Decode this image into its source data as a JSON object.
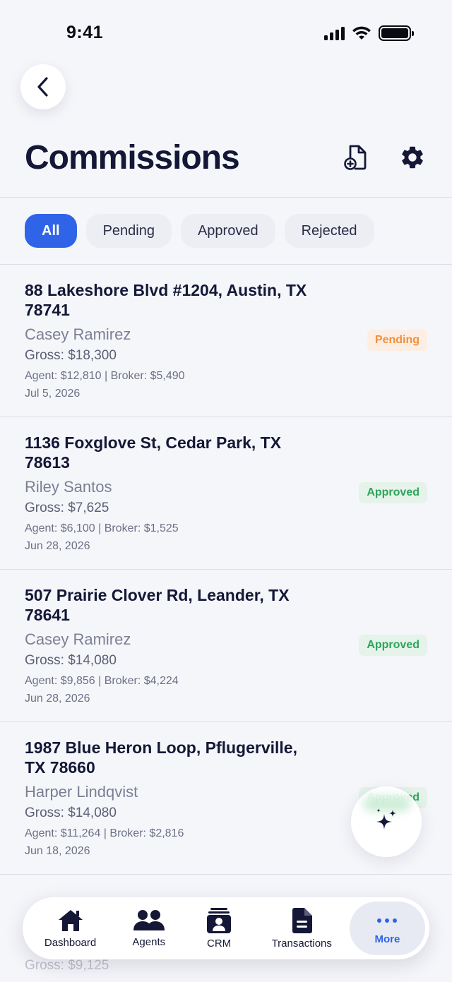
{
  "status_bar": {
    "time": "9:41"
  },
  "header": {
    "title": "Commissions"
  },
  "filters": [
    {
      "label": "All",
      "active": true
    },
    {
      "label": "Pending",
      "active": false
    },
    {
      "label": "Approved",
      "active": false
    },
    {
      "label": "Rejected",
      "active": false
    }
  ],
  "commissions": [
    {
      "address": "88 Lakeshore Blvd #1204, Austin, TX 78741",
      "agent": "Casey Ramirez",
      "gross": "Gross: $18,300",
      "split": "Agent: $12,810 | Broker: $5,490",
      "date": "Jul 5, 2026",
      "status": "Pending"
    },
    {
      "address": "1136 Foxglove St, Cedar Park, TX 78613",
      "agent": "Riley Santos",
      "gross": "Gross: $7,625",
      "split": "Agent: $6,100 | Broker: $1,525",
      "date": "Jun 28, 2026",
      "status": "Approved"
    },
    {
      "address": "507 Prairie Clover Rd, Leander, TX 78641",
      "agent": "Casey Ramirez",
      "gross": "Gross: $14,080",
      "split": "Agent: $9,856 | Broker: $4,224",
      "date": "Jun 28, 2026",
      "status": "Approved"
    },
    {
      "address": "1987 Blue Heron Loop, Pflugerville, TX 78660",
      "agent": "Harper Lindqvist",
      "gross": "Gross: $14,080",
      "split": "Agent: $11,264 | Broker: $2,816",
      "date": "Jun 18, 2026",
      "status": "Approved"
    },
    {
      "address": "",
      "agent": "",
      "gross": "Gross: $9,125",
      "split": "",
      "date": "",
      "status": ""
    }
  ],
  "bottom_nav": [
    {
      "label": "Dashboard",
      "icon": "home-icon"
    },
    {
      "label": "Agents",
      "icon": "users-icon"
    },
    {
      "label": "CRM",
      "icon": "contacts-icon"
    },
    {
      "label": "Transactions",
      "icon": "document-icon"
    },
    {
      "label": "More",
      "icon": "more-icon",
      "active": true
    }
  ],
  "colors": {
    "accent": "#2f63e8",
    "pending": "#f0903e",
    "approved": "#2fa45b",
    "text_primary": "#141836"
  }
}
